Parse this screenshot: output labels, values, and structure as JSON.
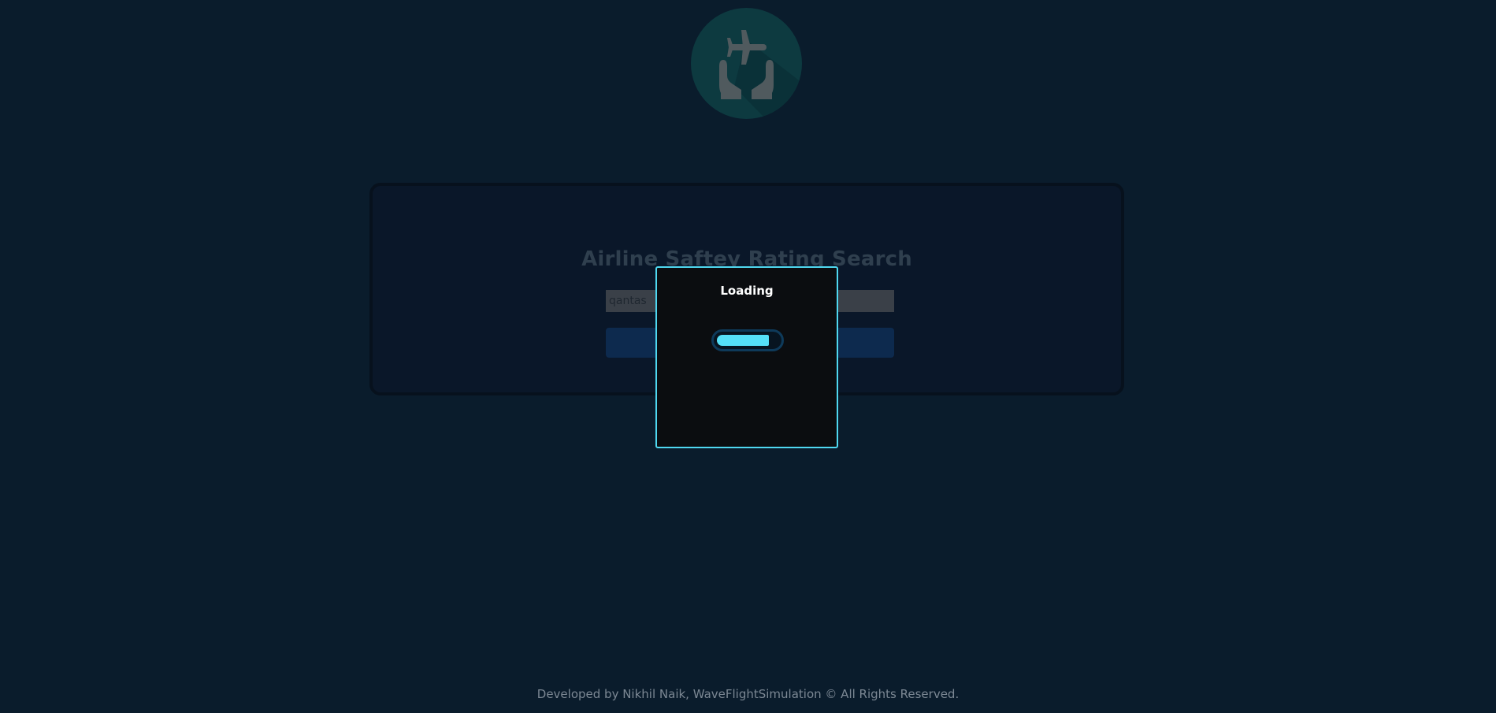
{
  "header": {
    "logo_icon": "airplane-in-hands-icon"
  },
  "search_card": {
    "title": "Airline Saftey Rating Search",
    "input_value": "qantas",
    "button_label": ""
  },
  "loading_dialog": {
    "title": "Loading",
    "progress": 0.85
  },
  "footer": {
    "text": "Developed by Nikhil Naik, WaveFlightSimulation © All Rights Reserved."
  },
  "colors": {
    "background": "#0a1c2c",
    "accent": "#4fd8f0",
    "progress_fill": "#55e0f8",
    "logo_circle": "#0d3a40"
  }
}
